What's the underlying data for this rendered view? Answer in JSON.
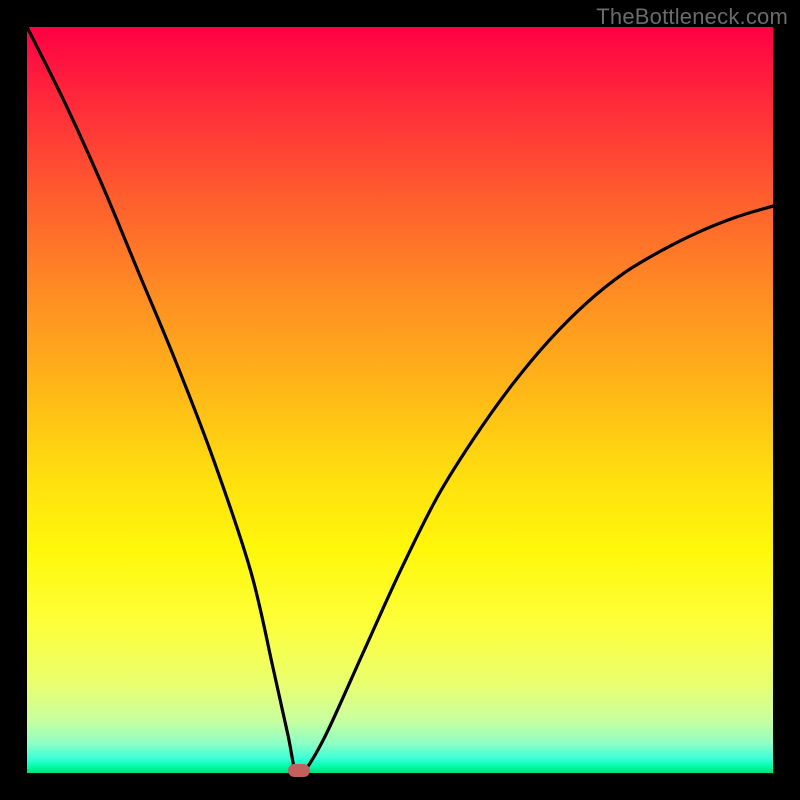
{
  "watermark": "TheBottleneck.com",
  "chart_data": {
    "type": "line",
    "title": "",
    "xlabel": "",
    "ylabel": "",
    "xlim": [
      0,
      100
    ],
    "ylim": [
      0,
      100
    ],
    "grid": false,
    "legend": false,
    "gradient_background": {
      "top_color": "#ff0044",
      "bottom_color": "#00e078",
      "direction": "vertical"
    },
    "series": [
      {
        "name": "bottleneck-curve",
        "x": [
          0,
          5,
          10,
          15,
          20,
          25,
          30,
          33,
          35,
          36,
          37,
          40,
          45,
          50,
          55,
          60,
          65,
          70,
          75,
          80,
          85,
          90,
          95,
          100
        ],
        "y": [
          100,
          90,
          79,
          67,
          55,
          42,
          27,
          14,
          5,
          0,
          0,
          5,
          16,
          27,
          37,
          45,
          52,
          58,
          63,
          67,
          70,
          72.5,
          74.5,
          76
        ],
        "optimum": {
          "x": 36.5,
          "y": 0
        }
      }
    ],
    "marker": {
      "x_pct": 36.5,
      "y_pct": 0,
      "color": "#c1605d"
    }
  }
}
